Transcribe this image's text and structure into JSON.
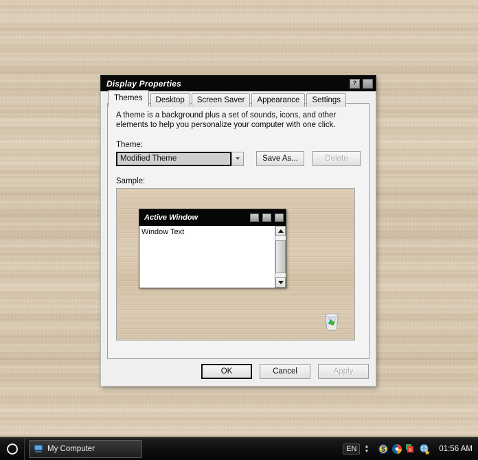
{
  "desktop": {
    "wallpaper_name": "wood-texture-wallpaper",
    "wallpaper_color": "#d5c3a8"
  },
  "dialog": {
    "title": "Display Properties",
    "titlebar_color": "#080808",
    "help_button": "?",
    "close_button": "■",
    "tabs": [
      {
        "label": "Themes",
        "selected": true
      },
      {
        "label": "Desktop",
        "selected": false
      },
      {
        "label": "Screen Saver",
        "selected": false
      },
      {
        "label": "Appearance",
        "selected": false
      },
      {
        "label": "Settings",
        "selected": false
      }
    ],
    "description": "A theme is a background plus a set of sounds, icons, and other elements to help you personalize your computer with one click.",
    "theme": {
      "label": "Theme:",
      "value": "Modified Theme",
      "dropdown_icon": "chevron-down-icon"
    },
    "buttons": {
      "save_as": "Save As...",
      "delete": "Delete",
      "delete_disabled": true,
      "ok": "OK",
      "cancel": "Cancel",
      "apply": "Apply",
      "apply_disabled": true
    },
    "sample": {
      "label": "Sample:",
      "window_title": "Active Window",
      "window_text": "Window Text",
      "window_buttons": [
        "minimize",
        "maximize",
        "close"
      ],
      "desktop_icon": "recycle-bin-icon"
    }
  },
  "taskbar": {
    "start_button": "start-orb-icon",
    "tasks": [
      {
        "label": "My Computer",
        "icon": "my-computer-icon"
      }
    ],
    "tray": {
      "language": "EN",
      "expand_icon": "chevron-icon",
      "icons": [
        "skype-icon",
        "media-player-icon",
        "antivirus-icon",
        "network-globe-icon"
      ],
      "clock": "01:56 AM"
    }
  }
}
